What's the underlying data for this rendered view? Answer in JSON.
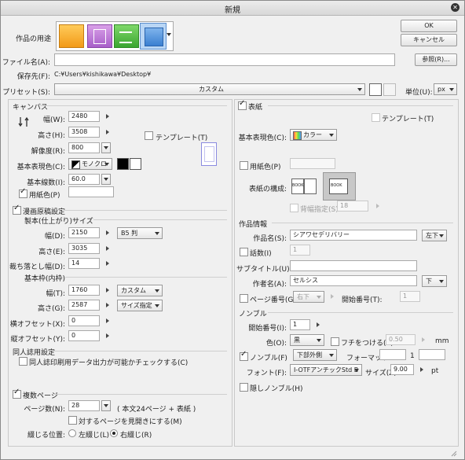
{
  "title": "新規",
  "buttons": {
    "ok": "OK",
    "cancel": "キャンセル",
    "browse": "参照(R)..."
  },
  "purpose_label": "作品の用途",
  "file_name": {
    "label": "ファイル名(A):",
    "value": ""
  },
  "save_to": {
    "label": "保存先(F):",
    "value": "C:¥Users¥kishikawa¥Desktop¥"
  },
  "preset": {
    "label": "プリセット(S):",
    "value": "カスタム",
    "unit_label": "単位(U):",
    "unit_value": "px"
  },
  "canvas": {
    "header": "キャンバス",
    "width_label": "幅(W):",
    "width": "2480",
    "height_label": "高さ(H):",
    "height": "3508",
    "resolution_label": "解像度(R):",
    "resolution": "800",
    "template_label": "テンプレート(T)",
    "color_label": "基本表現色(C):",
    "color_value": "モノクロ",
    "line_label": "基本線数(I):",
    "line_value": "60.0",
    "paper_color_label": "用紙色(P)"
  },
  "manga": {
    "header": "漫画原稿設定",
    "bind_header": "製本(仕上がり)サイズ",
    "width_label": "幅(D):",
    "width": "2150",
    "size_preset": "B5 判",
    "height_label": "高さ(E):",
    "height": "3035",
    "bleed_label": "裁ち落とし幅(D):",
    "bleed": "14",
    "frame_header": "基本枠(内枠)",
    "fw_label": "幅(T):",
    "fw": "1760",
    "fw_preset": "カスタム",
    "fh_label": "高さ(G):",
    "fh": "2587",
    "fh_preset": "サイズ指定",
    "xoff_label": "横オフセット(X):",
    "xoff": "0",
    "yoff_label": "縦オフセット(Y):",
    "yoff": "0"
  },
  "doujin": {
    "header": "同人誌用設定",
    "check_label": "同人誌印刷用データ出力が可能かチェックする(C)"
  },
  "multipage": {
    "header": "複数ページ",
    "pages_label": "ページ数(N):",
    "pages": "28",
    "pages_note": "( 本文24ページ + 表紙 )",
    "spread_label": "対するページを見開きにする(M)",
    "binding_label": "綴じる位置:",
    "left": "左綴じ(L)",
    "right": "右綴じ(R)"
  },
  "cover": {
    "header": "表紙",
    "template_label": "テンプレート(T)",
    "color_label": "基本表現色(C):",
    "color_value": "カラー",
    "paper_color_label": "用紙色(P)",
    "composition_label": "表紙の構成:",
    "book": "BOOK",
    "spine_label": "背幅指定(S):",
    "spine": "18"
  },
  "work_info": {
    "header": "作品情報",
    "title_label": "作品名(S):",
    "title_value": "シアワセデリバリー",
    "title_pos": "左下",
    "episode_label": "話数(I)",
    "episode": "1",
    "subtitle_label": "サブタイトル(U):",
    "subtitle": "",
    "author_label": "作者名(A):",
    "author": "セルシス",
    "author_pos": "下",
    "page_no_label": "ページ番号(G):",
    "page_no_pos": "右下",
    "start_label": "開始番号(T):",
    "start": "1"
  },
  "nombre": {
    "header": "ノンブル",
    "start_label": "開始番号(I):",
    "start": "1",
    "color_label": "色(O):",
    "color_value": "黒",
    "edge_label": "フチをつける(E):",
    "edge_value": "0.50",
    "edge_unit": "mm",
    "nombre_label": "ノンブル(F)",
    "nombre_pos": "下部外側",
    "format_label": "フォーマット:",
    "format_value": "1",
    "font_label": "フォント(F):",
    "font_value": "I-OTFアンチックStd B",
    "size_label": "サイズ(Z):",
    "size_value": "9.00",
    "size_unit": "pt",
    "hidden_label": "隠しノンブル(H)"
  }
}
